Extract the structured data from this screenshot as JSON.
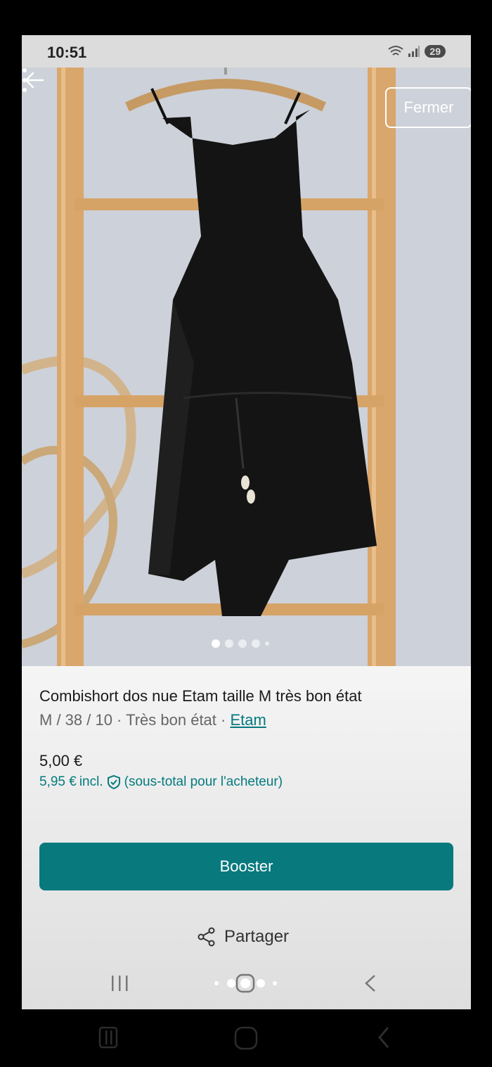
{
  "status_bar": {
    "time": "10:51",
    "battery": "29"
  },
  "top_actions": {
    "fermer_label": "Fermer"
  },
  "carousel": {
    "count": 5,
    "active_index": 0
  },
  "item": {
    "title": "Combishort dos nue Etam taille M très bon état",
    "details": "M / 38 / 10 · Très bon état · ",
    "brand": "Etam",
    "price": "5,00 €",
    "total_price": "5,95 €",
    "total_suffix": "incl.",
    "total_note": "(sous-total pour l'acheteur)"
  },
  "actions": {
    "booster_label": "Booster",
    "share_label": "Partager"
  },
  "colors": {
    "accent": "#08797d",
    "link": "#047a7e"
  }
}
